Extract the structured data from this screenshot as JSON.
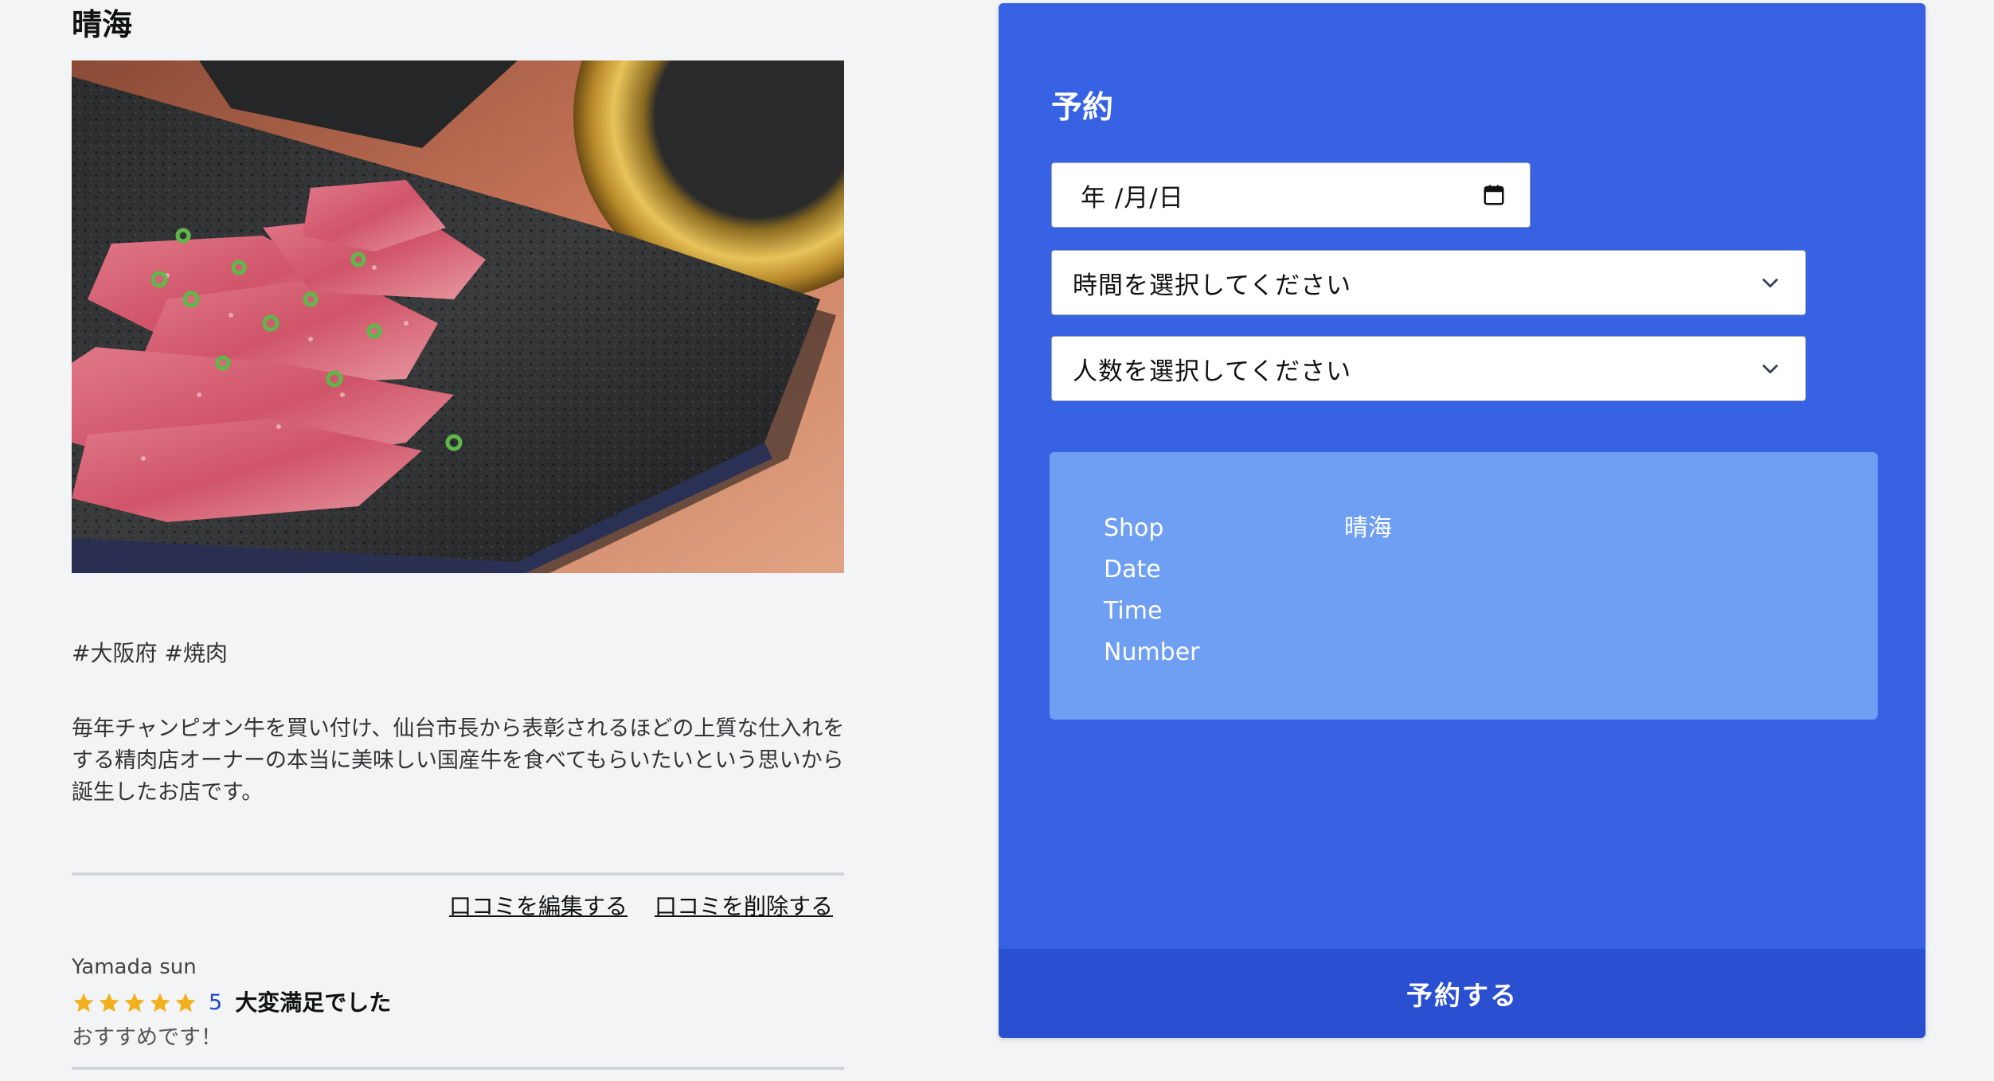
{
  "shop": {
    "name": "晴海",
    "photo_alt": "焼肉",
    "tags": "#大阪府 #焼肉",
    "description": "毎年チャンピオン牛を買い付け、仙台市長から表彰されるほどの上質な仕入れをする精肉店オーナーの本当に美味しい国産牛を食べてもらいたいという思いから誕生したお店です。"
  },
  "review_actions": {
    "edit_label": "口コミを編集する",
    "delete_label": "口コミを削除する"
  },
  "review": {
    "author": "Yamada sun",
    "rating": 5,
    "rating_label": "5",
    "title": "大変満足でした",
    "body": "おすすめです！"
  },
  "reservation": {
    "title": "予約",
    "date_placeholder": "年 /月/日",
    "time_placeholder": "時間を選択してください",
    "number_placeholder": "人数を選択してください",
    "summary": {
      "shop_label": "Shop",
      "shop_value": "晴海",
      "date_label": "Date",
      "date_value": "",
      "time_label": "Time",
      "time_value": "",
      "number_label": "Number",
      "number_value": ""
    },
    "submit_label": "予約する"
  },
  "colors": {
    "panel": "#3762e4",
    "summary_box": "#6e9ff2",
    "submit": "#2a4fd0",
    "star": "#f2b01e",
    "rating_number": "#2547c9"
  },
  "icons": {
    "calendar": "calendar-icon",
    "select_arrow": "chevron-down-icon",
    "star": "star-icon"
  }
}
